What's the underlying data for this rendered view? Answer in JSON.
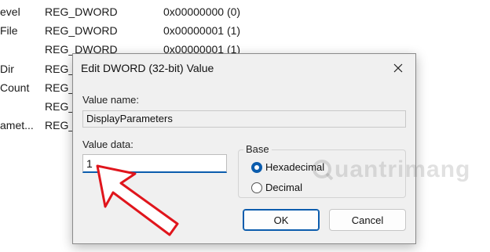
{
  "registry": {
    "rows": [
      {
        "name": "evel",
        "type": "REG_DWORD",
        "data": "0x00000000 (0)"
      },
      {
        "name": "File",
        "type": "REG_DWORD",
        "data": "0x00000001 (1)"
      },
      {
        "name": "",
        "type": "REG_DWORD",
        "data": "0x00000001 (1)"
      },
      {
        "name": "Dir",
        "type": "REG_",
        "data": ""
      },
      {
        "name": "Count",
        "type": "REG_",
        "data": ""
      },
      {
        "name": "",
        "type": "REG_",
        "data": ""
      },
      {
        "name": "amet...",
        "type": "REG_",
        "data": ""
      }
    ]
  },
  "dialog": {
    "title": "Edit DWORD (32-bit) Value",
    "close_icon": "close-icon",
    "value_name_label": "Value name:",
    "value_name": "DisplayParameters",
    "value_data_label": "Value data:",
    "value_data": "1",
    "base_label": "Base",
    "base_options": [
      {
        "label": "Hexadecimal",
        "selected": true
      },
      {
        "label": "Decimal",
        "selected": false
      }
    ],
    "ok_label": "OK",
    "cancel_label": "Cancel"
  },
  "watermark": "uantrimang",
  "colors": {
    "accent": "#0b5cad",
    "arrow": "#e0151c"
  }
}
